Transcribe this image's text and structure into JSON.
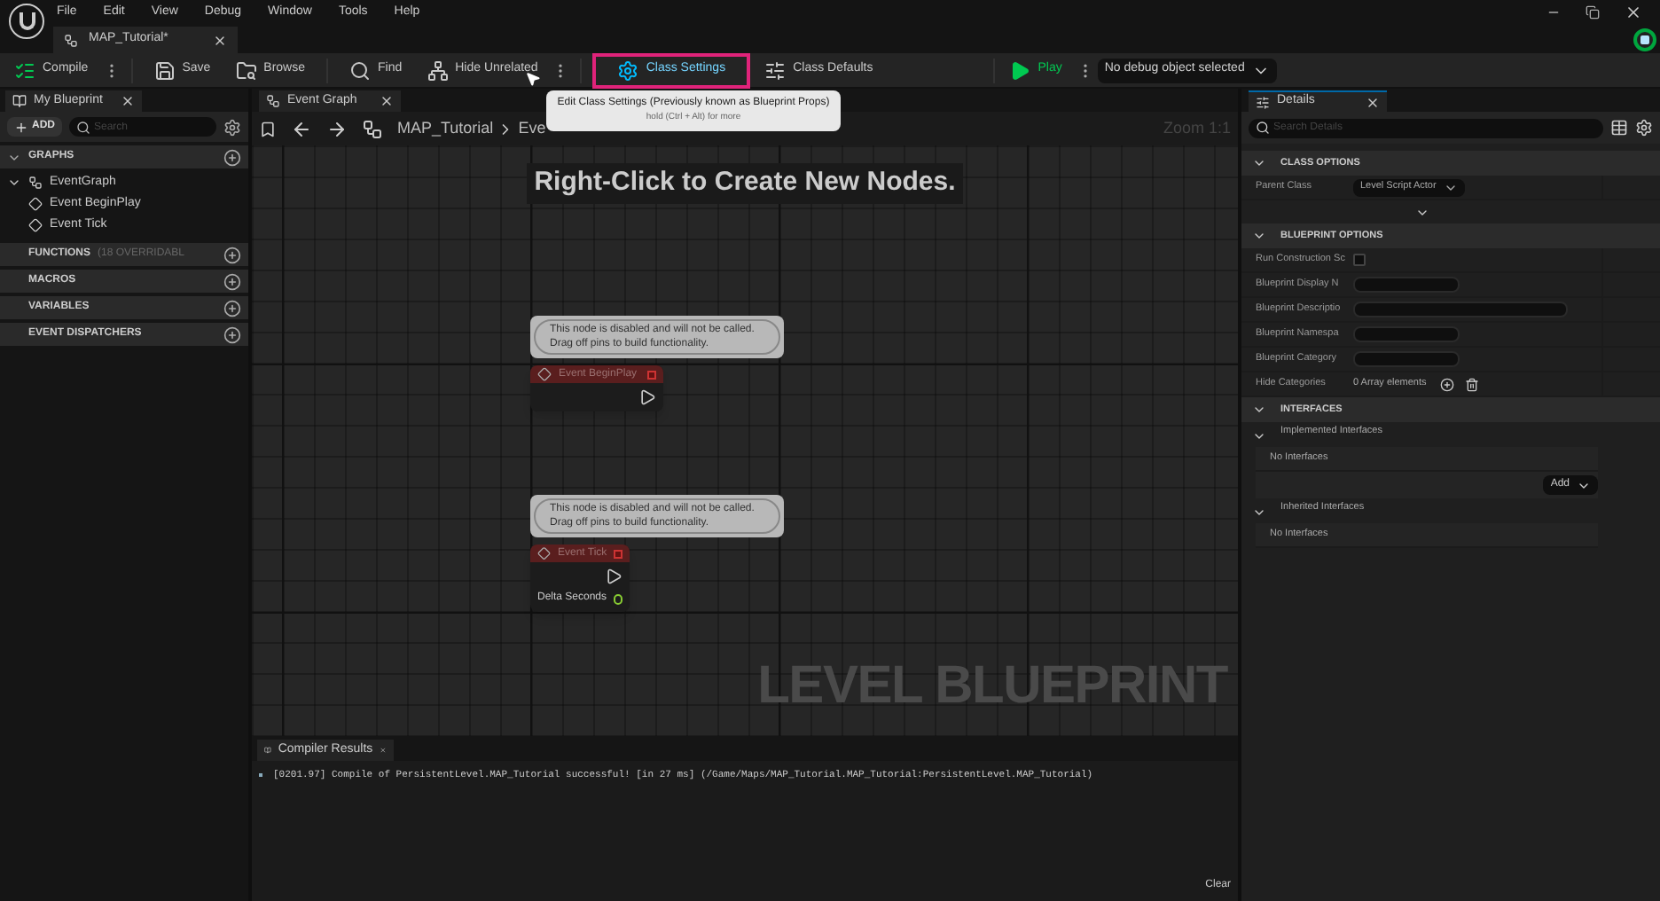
{
  "menu": [
    "File",
    "Edit",
    "View",
    "Debug",
    "Window",
    "Tools",
    "Help"
  ],
  "document_tab": {
    "label": "MAP_Tutorial*"
  },
  "toolbar": [
    {
      "kind": "compile",
      "label": "Compile",
      "highlighted": false
    },
    {
      "kind": "save",
      "label": "Save",
      "highlighted": false
    },
    {
      "kind": "browse",
      "label": "Browse",
      "highlighted": false
    },
    {
      "kind": "find",
      "label": "Find",
      "highlighted": false
    },
    {
      "kind": "hide",
      "label": "Hide Unrelated",
      "highlighted": false
    },
    {
      "kind": "class_settings",
      "label": "Class Settings",
      "highlighted": true
    },
    {
      "kind": "class_defaults",
      "label": "Class Defaults",
      "highlighted": false
    },
    {
      "kind": "play",
      "label": "Play",
      "highlighted": false
    },
    {
      "kind": "dropdown",
      "label": "No debug object selected",
      "highlighted": false
    }
  ],
  "tooltip": {
    "title": "Edit Class Settings (Previously known as Blueprint Props)",
    "hint": "hold (Ctrl + Alt) for more"
  },
  "my_blueprint": {
    "tab": "My Blueprint",
    "add_button": "ADD",
    "search": {
      "placeholder": "Search"
    },
    "sections": [
      {
        "title": "GRAPHS",
        "expanded": true,
        "children": [
          {
            "label": "EventGraph",
            "expanded": true,
            "children": [
              {
                "label": "Event BeginPlay"
              },
              {
                "label": "Event Tick"
              }
            ]
          }
        ]
      },
      {
        "title": "FUNCTIONS",
        "note": "(18 OVERRIDABL",
        "expanded": false
      },
      {
        "title": "MACROS",
        "expanded": false
      },
      {
        "title": "VARIABLES",
        "expanded": false
      },
      {
        "title": "EVENT DISPATCHERS",
        "expanded": false
      }
    ]
  },
  "graph": {
    "tab": "Event Graph",
    "breadcrumb": [
      "MAP_Tutorial",
      "Eve"
    ],
    "zoom": "Zoom 1:1",
    "hint": "Right-Click to Create New Nodes.",
    "watermark": "LEVEL BLUEPRINT",
    "nodes": [
      {
        "comment": "This node is disabled and will not be called.\nDrag off pins to build functionality.",
        "title": "Event BeginPlay"
      },
      {
        "comment": "This node is disabled and will not be called.\nDrag off pins to build functionality.",
        "title": "Event Tick",
        "pin": "Delta Seconds"
      }
    ]
  },
  "compiler_results": {
    "tab": "Compiler Results",
    "messages": [
      "[0201.97] Compile of PersistentLevel.MAP_Tutorial successful! [in 27 ms] (/Game/Maps/MAP_Tutorial.MAP_Tutorial:PersistentLevel.MAP_Tutorial)"
    ],
    "clear": "Clear"
  },
  "details": {
    "tab": "Details",
    "search": {
      "placeholder": "Search Details"
    },
    "sections": [
      {
        "title": "CLASS OPTIONS",
        "expanded": true,
        "advanced": true,
        "rows": [
          {
            "kind": "dropdown",
            "label": "Parent Class",
            "value": "Level Script Actor"
          }
        ]
      },
      {
        "title": "BLUEPRINT OPTIONS",
        "expanded": true,
        "rows": [
          {
            "kind": "checkbox",
            "label": "Run Construction Sc",
            "checked": false
          },
          {
            "kind": "text",
            "label": "Blueprint Display N"
          },
          {
            "kind": "wide_text",
            "label": "Blueprint Descriptio"
          },
          {
            "kind": "text",
            "label": "Blueprint Namespa"
          },
          {
            "kind": "text",
            "label": "Blueprint Category"
          },
          {
            "kind": "array",
            "label": "Hide Categories",
            "value": "0 Array elements"
          }
        ]
      },
      {
        "title": "INTERFACES",
        "expanded": true,
        "groups": [
          {
            "title": "Implemented Interfaces",
            "expanded": true,
            "empty": "No Interfaces",
            "add": "Add"
          },
          {
            "title": "Inherited Interfaces",
            "expanded": true,
            "empty": "No Interfaces"
          }
        ]
      }
    ]
  }
}
